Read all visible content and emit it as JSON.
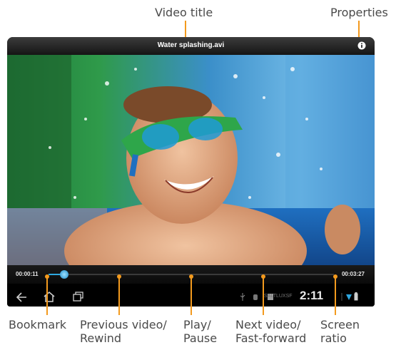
{
  "callouts": {
    "video_title": "Video title",
    "properties": "Properties",
    "bookmark": "Bookmark",
    "previous_line1": "Previous video/",
    "previous_line2": "Rewind",
    "play_line1": "Play/",
    "play_line2": "Pause",
    "next_line1": "Next video/",
    "next_line2": "Fast-forward",
    "screen_line1": "Screen",
    "screen_line2": "ratio"
  },
  "player": {
    "title": "Water splashing.avi",
    "elapsed": "00:00:11",
    "duration": "00:03:27",
    "progress_fraction": 0.055
  },
  "status_bar": {
    "carrier": "SALTLUXSF",
    "time": "2:11"
  },
  "colors": {
    "accent_orange": "#f39a1e",
    "progress_blue": "#2ea7e0"
  },
  "icons": [
    "info-icon",
    "bookmark-icon",
    "previous-icon",
    "pause-icon",
    "next-icon",
    "screen-ratio-icon",
    "back-icon",
    "home-icon",
    "recent-apps-icon"
  ]
}
